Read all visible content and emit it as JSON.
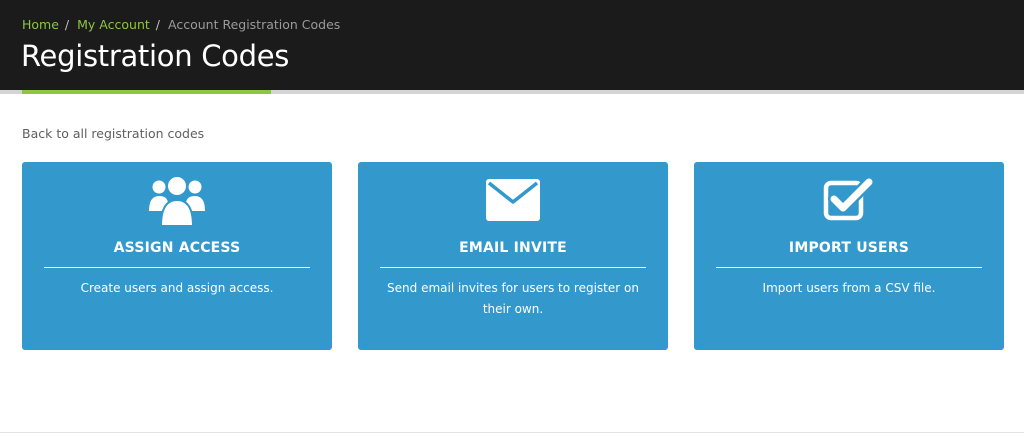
{
  "header": {
    "breadcrumb": {
      "home": "Home",
      "separator": "/",
      "my_account": "My Account",
      "current": "Account Registration Codes"
    },
    "title": "Registration Codes"
  },
  "back_link": "Back to all registration codes",
  "cards": [
    {
      "icon": "users-icon",
      "title": "ASSIGN ACCESS",
      "description": "Create users and assign access."
    },
    {
      "icon": "envelope-icon",
      "title": "EMAIL INVITE",
      "description": "Send email invites for users to register on their own."
    },
    {
      "icon": "checkbox-icon",
      "title": "IMPORT USERS",
      "description": "Import users from a CSV file."
    }
  ],
  "colors": {
    "header_bg": "#1b1b1b",
    "accent_green": "#8dc63f",
    "card_blue": "#3399cc"
  }
}
